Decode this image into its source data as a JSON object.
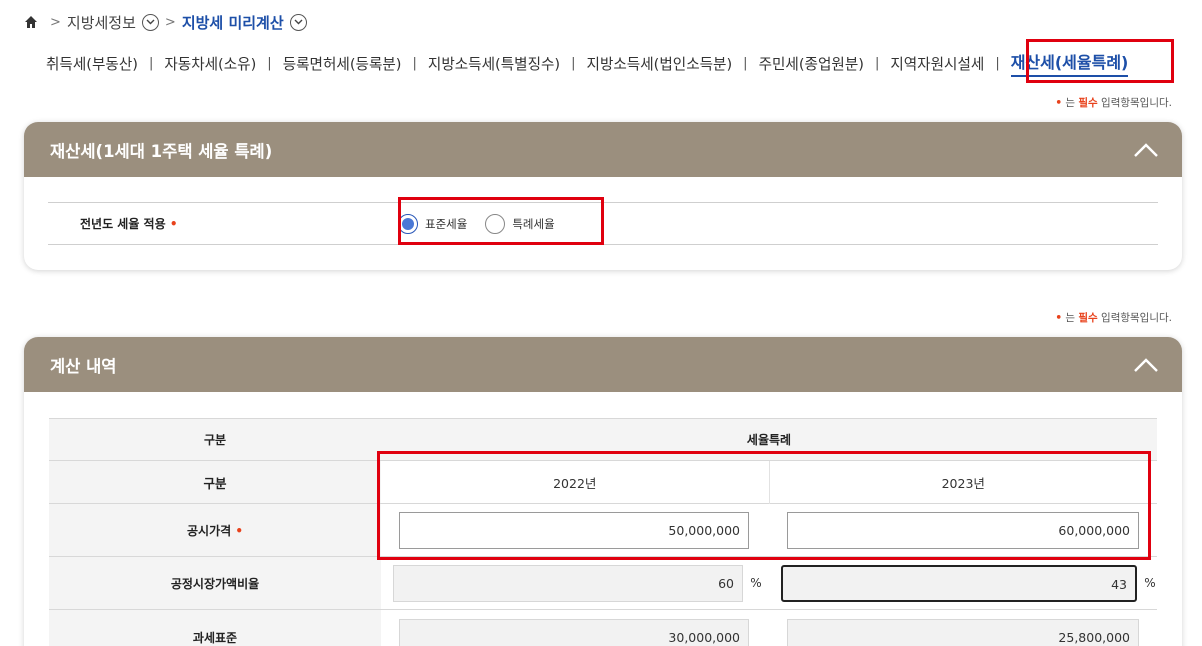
{
  "breadcrumb": {
    "parent": "지방세정보",
    "current": "지방세 미리계산"
  },
  "tabs": [
    {
      "label": "취득세(부동산)"
    },
    {
      "label": "자동차세(소유)"
    },
    {
      "label": "등록면허세(등록분)"
    },
    {
      "label": "지방소득세(특별징수)"
    },
    {
      "label": "지방소득세(법인소득분)"
    },
    {
      "label": "주민세(종업원분)"
    },
    {
      "label": "지역자원시설세"
    },
    {
      "label": "재산세(세율특례)"
    }
  ],
  "tab_separator": "|",
  "required_note": {
    "dot": "•",
    "prefix": "는 ",
    "must": "필수",
    "suffix": " 입력항목입니다."
  },
  "panel1": {
    "title": "재산세(1세대 1주택 세율 특례)",
    "field_label": "전년도 세율 적용",
    "required_dot": "•",
    "options": [
      {
        "label": "표준세율",
        "checked": true
      },
      {
        "label": "특례세율",
        "checked": false
      }
    ]
  },
  "panel2": {
    "title": "계산 내역",
    "header": {
      "col1": "구분",
      "col2": "세율특례"
    },
    "rows": {
      "year": {
        "label": "구분",
        "v1": "2022년",
        "v2": "2023년"
      },
      "price": {
        "label": "공시가격",
        "dot": "•",
        "v1": "50,000,000",
        "v2": "60,000,000"
      },
      "ratio": {
        "label": "공정시장가액비율",
        "v1": "60",
        "v2": "43",
        "unit": "%"
      },
      "base": {
        "label": "과세표준",
        "v1": "30,000,000",
        "v2": "25,800,000"
      }
    }
  },
  "colors": {
    "accent": "#1d4fa8",
    "panel_header": "#9b8f7e",
    "highlight": "#e0000f",
    "required": "#e8421c"
  }
}
